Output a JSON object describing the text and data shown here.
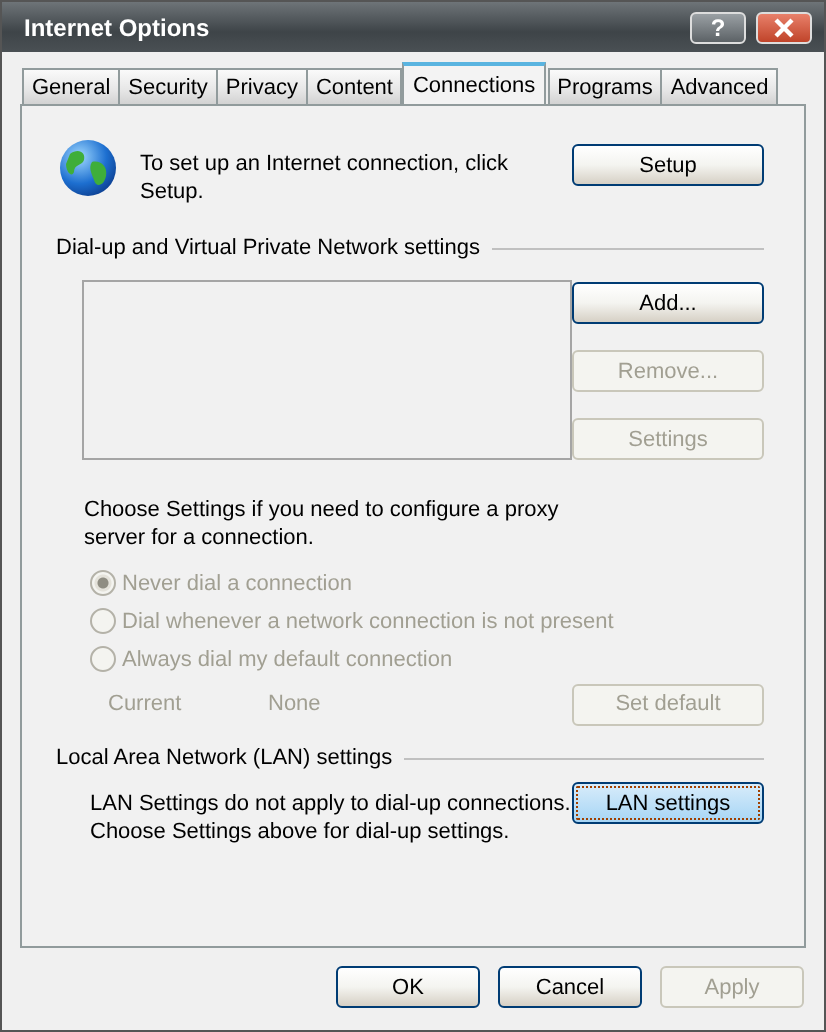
{
  "window": {
    "title": "Internet Options",
    "help_button": "?"
  },
  "tabs": [
    {
      "label": "General",
      "selected": false
    },
    {
      "label": "Security",
      "selected": false
    },
    {
      "label": "Privacy",
      "selected": false
    },
    {
      "label": "Content",
      "selected": false
    },
    {
      "label": "Connections",
      "selected": true
    },
    {
      "label": "Programs",
      "selected": false
    },
    {
      "label": "Advanced",
      "selected": false
    }
  ],
  "setup": {
    "text": "To set up an Internet connection, click Setup.",
    "button": {
      "label": "Setup",
      "disabled": false,
      "focused": false
    }
  },
  "dialup": {
    "heading": "Dial-up and Virtual Private Network settings",
    "buttons": [
      {
        "label": "Add...",
        "disabled": false,
        "focused": false
      },
      {
        "label": "Remove...",
        "disabled": true,
        "focused": false
      },
      {
        "label": "Settings",
        "disabled": true,
        "focused": false
      }
    ],
    "proxy_note": "Choose Settings if you need to configure a proxy server for a connection.",
    "options": [
      {
        "label": "Never dial a connection",
        "selected": true,
        "disabled": true
      },
      {
        "label": "Dial whenever a network connection is not present",
        "selected": false,
        "disabled": true
      },
      {
        "label": "Always dial my default connection",
        "selected": false,
        "disabled": true
      }
    ],
    "current_label": "Current",
    "current_value": "None",
    "set_default": {
      "label": "Set default",
      "disabled": true,
      "focused": false
    }
  },
  "lan": {
    "heading": "Local Area Network (LAN) settings",
    "note": "LAN Settings do not apply to dial-up connections. Choose Settings above for dial-up settings.",
    "button": {
      "label": "LAN settings",
      "disabled": false,
      "focused": true
    }
  },
  "footer_buttons": [
    {
      "label": "OK",
      "disabled": false,
      "focused": false
    },
    {
      "label": "Cancel",
      "disabled": false,
      "focused": false
    },
    {
      "label": "Apply",
      "disabled": true,
      "focused": false
    }
  ]
}
